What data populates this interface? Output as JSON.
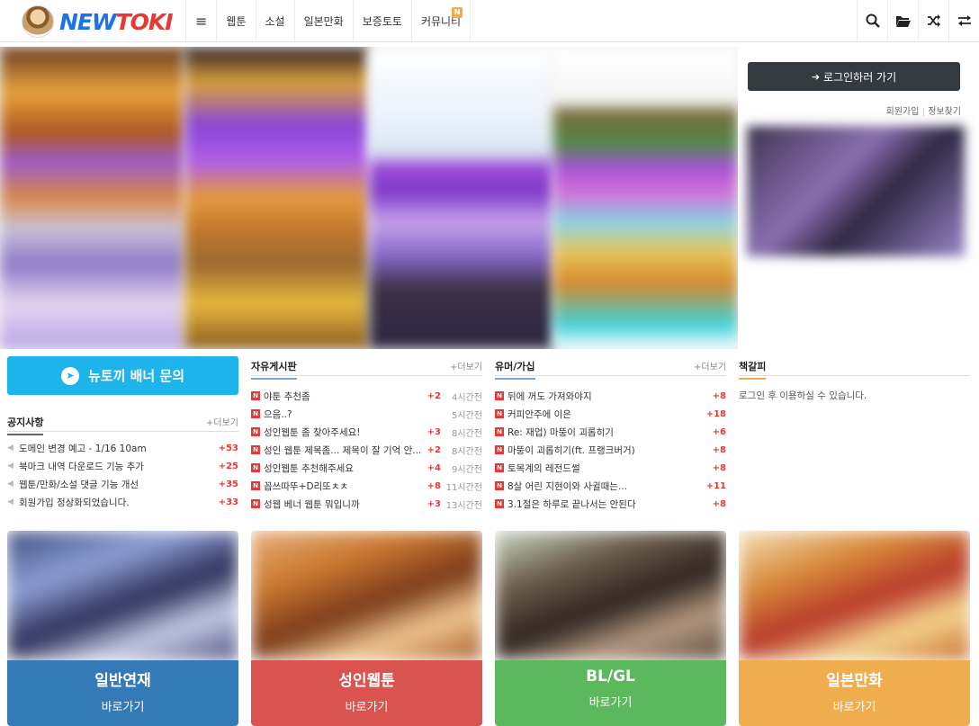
{
  "header": {
    "logo_new": "NEW",
    "logo_toki": "TOKI",
    "nav": [
      {
        "label": "≡",
        "badge": ""
      },
      {
        "label": "웹툰",
        "badge": ""
      },
      {
        "label": "소설",
        "badge": ""
      },
      {
        "label": "일본만화",
        "badge": ""
      },
      {
        "label": "보증토토",
        "badge": ""
      },
      {
        "label": "커뮤니티",
        "badge": "N"
      }
    ],
    "icons": [
      "search-icon",
      "folder-icon",
      "shuffle-icon",
      "swap-icon"
    ]
  },
  "sidebar": {
    "login_button": "로그인하러 가기",
    "signup": "회원가입",
    "find_info": "정보찾기"
  },
  "banner_inquiry": "뉴토끼 배너 문의",
  "notice": {
    "title": "공지사항",
    "more": "+더보기",
    "items": [
      {
        "text": "도메인 변경 예고 - 1/16 10am",
        "count": "+53"
      },
      {
        "text": "북마크 내역 다운로드 기능 추가",
        "count": "+25"
      },
      {
        "text": "웹툰/만화/소설 댓글 기능 개선",
        "count": "+35"
      },
      {
        "text": "회원가입 정상화되었습니다.",
        "count": "+33"
      }
    ]
  },
  "free_board": {
    "title": "자유게시판",
    "more": "+더보기",
    "items": [
      {
        "text": "야툰 추천좀",
        "count": "+2",
        "time": "4시간전"
      },
      {
        "text": "으음..?",
        "count": "",
        "time": "5시간전"
      },
      {
        "text": "성인웹툰 좀 찾아주세요!",
        "count": "+3",
        "time": "8시간전"
      },
      {
        "text": "성인 웹툰 제목좀... 제목이 잘 기억 안...",
        "count": "+2",
        "time": "8시간전"
      },
      {
        "text": "성인웹툰 추천해주세요",
        "count": "+4",
        "time": "9시간전"
      },
      {
        "text": "꼽쓰따뚜+D리또ㅊㅊ",
        "count": "+8",
        "time": "11시간전"
      },
      {
        "text": "성웹 베너 웹툰 뭐입니까",
        "count": "+3",
        "time": "13시간전"
      }
    ]
  },
  "humor_board": {
    "title": "유머/가십",
    "more": "+더보기",
    "items": [
      {
        "text": "뒤에 꺼도 가져와야지",
        "count": "+8"
      },
      {
        "text": "커피안주에 이은",
        "count": "+18"
      },
      {
        "text": "Re: 재업) 마뚱이 괴롭히기",
        "count": "+6"
      },
      {
        "text": "마뚱이 괴롭히기(ft. 프랭크버거)",
        "count": "+8"
      },
      {
        "text": "토목계의 레전드썰",
        "count": "+8"
      },
      {
        "text": "8살 어린 지현이와 사귈때는...",
        "count": "+11"
      },
      {
        "text": "3.1절은 하루로 끝나서는 안된다",
        "count": "+8"
      }
    ]
  },
  "bookmark": {
    "title": "책갈피",
    "note": "로그인 후 이용하실 수 있습니다."
  },
  "categories": [
    {
      "title": "일반연재",
      "sub": "바로가기",
      "color": "#337ab7"
    },
    {
      "title": "성인웹툰",
      "sub": "바로가기",
      "color": "#d9534f"
    },
    {
      "title": "BL/GL",
      "sub": "바로가기",
      "color": "#5cb85c"
    },
    {
      "title": "일본만화",
      "sub": "바로가기",
      "color": "#f0ad4e"
    }
  ]
}
